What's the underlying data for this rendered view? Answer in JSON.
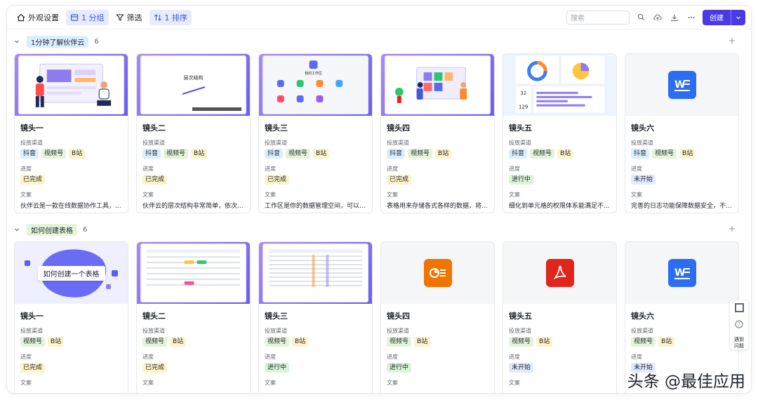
{
  "toolbar": {
    "appearance": "外观设置",
    "group": "1 分组",
    "filter": "筛选",
    "sort": "1 排序",
    "search_placeholder": "搜索",
    "create": "创建"
  },
  "field_labels": {
    "channel": "投放渠道",
    "progress": "进度",
    "copy": "文案"
  },
  "groups": [
    {
      "name": "1分钟了解伙伴云",
      "count": "6",
      "cards": [
        {
          "title": "镜头一",
          "channels": [
            "抖音",
            "视频号",
            "B站"
          ],
          "progress": "已完成",
          "text": "伙伴云是一款在线数据协作工具，..."
        },
        {
          "title": "镜头二",
          "channels": [
            "抖音",
            "视频号",
            "B站"
          ],
          "progress": "已完成",
          "text": "伙伴云的层次结构非常简单，依次..."
        },
        {
          "title": "镜头三",
          "channels": [
            "抖音",
            "视频号",
            "B站"
          ],
          "progress": "已完成",
          "text": "工作区是你的数据管理空间，可以..."
        },
        {
          "title": "镜头四",
          "channels": [
            "抖音",
            "视频号",
            "B站"
          ],
          "progress": "已完成",
          "text": "表格用来存储各式各样的数据，将..."
        },
        {
          "title": "镜头五",
          "channels": [
            "抖音",
            "视频号",
            "B站"
          ],
          "progress": "进行中",
          "text": "细化到单元格的权限体系能满足不..."
        },
        {
          "title": "镜头六",
          "channels": [
            "抖音",
            "视频号",
            "B站"
          ],
          "progress": "未开始",
          "text": "完善的日志功能保障数据安全，不..."
        }
      ]
    },
    {
      "name": "如何创建表格",
      "count": "6",
      "cards": [
        {
          "title": "镜头一",
          "channels": [
            "视频号",
            "B站"
          ],
          "progress": "已完成"
        },
        {
          "title": "镜头二",
          "channels": [
            "视频号",
            "B站"
          ],
          "progress": "已完成"
        },
        {
          "title": "镜头三",
          "channels": [
            "视频号",
            "B站"
          ],
          "progress": "进行中"
        },
        {
          "title": "镜头四",
          "channels": [
            "视频号",
            "B站"
          ],
          "progress": "进行中"
        },
        {
          "title": "镜头五",
          "channels": [
            "视频号",
            "B站"
          ],
          "progress": "未开始"
        },
        {
          "title": "镜头六",
          "channels": [
            "视频号",
            "B站"
          ],
          "progress": "未开始"
        }
      ]
    }
  ],
  "covers": {
    "layers_title": "层次结构",
    "workspace_title": "我的工作区",
    "create_table_caption": "如何创建一个表格",
    "stat_a": "32",
    "stat_b": "129"
  },
  "side_help": "遇到\n问题",
  "watermark": "头条 @最佳应用"
}
